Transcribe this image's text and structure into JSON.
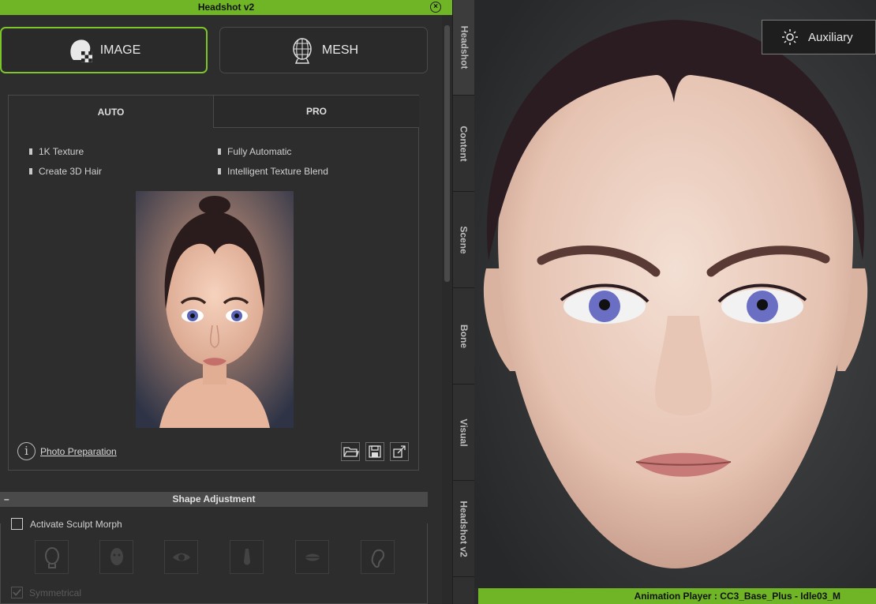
{
  "window": {
    "title": "Headshot v2"
  },
  "mode_buttons": {
    "image": "IMAGE",
    "mesh": "MESH"
  },
  "tabs": {
    "auto": "AUTO",
    "pro": "PRO"
  },
  "features": [
    "1K Texture",
    "Fully Automatic",
    "Create 3D Hair",
    "Intelligent Texture Blend"
  ],
  "photo_prep": {
    "label": "Photo Preparation",
    "info_glyph": "i"
  },
  "shape_adjustment": {
    "title": "Shape Adjustment",
    "collapse": "–"
  },
  "sculpt": {
    "label": "Activate Sculpt Morph",
    "checked": false,
    "buttons": [
      "head-icon",
      "face-icon",
      "eye-icon",
      "nose-icon",
      "mouth-icon",
      "ear-icon"
    ]
  },
  "symmetrical": {
    "label": "Symmetrical",
    "checked": true
  },
  "side_tabs": [
    "Headshot",
    "Content",
    "Scene",
    "Bone",
    "Visual",
    "Headshot v2"
  ],
  "viewport": {
    "auxiliary_label": "Auxiliary"
  },
  "status": {
    "text": "Animation Player : CC3_Base_Plus - Idle03_M"
  },
  "colors": {
    "accent": "#6fb526",
    "panel": "#2d2d2d"
  }
}
